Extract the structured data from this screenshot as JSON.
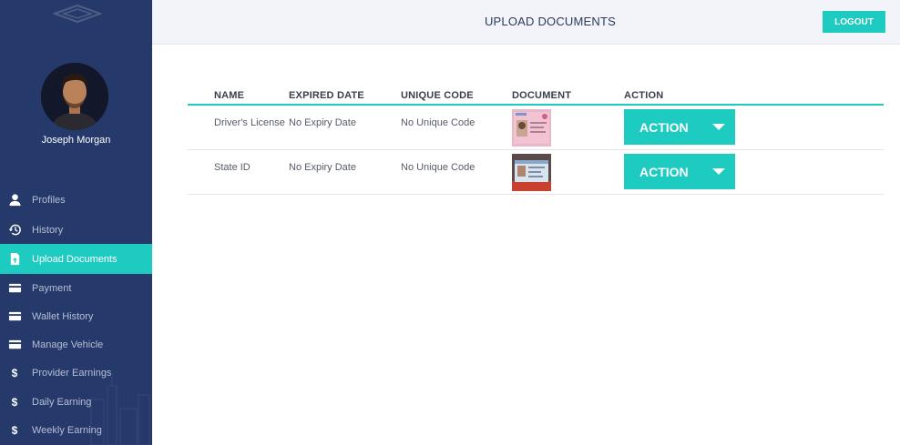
{
  "user": {
    "name": "Joseph Morgan"
  },
  "sidebar": {
    "items": [
      {
        "label": "Profiles",
        "icon": "person-icon"
      },
      {
        "label": "History",
        "icon": "history-icon"
      },
      {
        "label": "Upload Documents",
        "icon": "document-upload-icon",
        "active": true
      },
      {
        "label": "Payment",
        "icon": "card-icon"
      },
      {
        "label": "Wallet History",
        "icon": "card-icon"
      },
      {
        "label": "Manage Vehicle",
        "icon": "card-icon"
      },
      {
        "label": "Provider Earnings",
        "icon": "dollar-icon"
      },
      {
        "label": "Daily Earning",
        "icon": "dollar-icon"
      },
      {
        "label": "Weekly Earning",
        "icon": "dollar-icon"
      }
    ]
  },
  "header": {
    "title": "UPLOAD DOCUMENTS",
    "logout_label": "LOGOUT"
  },
  "table": {
    "columns": [
      "NAME",
      "EXPIRED DATE",
      "UNIQUE CODE",
      "DOCUMENT",
      "ACTION"
    ],
    "rows": [
      {
        "name": "Driver's License",
        "expired": "No Expiry Date",
        "code": "No Unique Code",
        "action": "ACTION"
      },
      {
        "name": "State ID",
        "expired": "No Expiry Date",
        "code": "No Unique Code",
        "action": "ACTION"
      }
    ]
  },
  "colors": {
    "accent": "#1ecbc0",
    "sidebar": "#25396b",
    "header_bg": "#f3f4f9"
  }
}
